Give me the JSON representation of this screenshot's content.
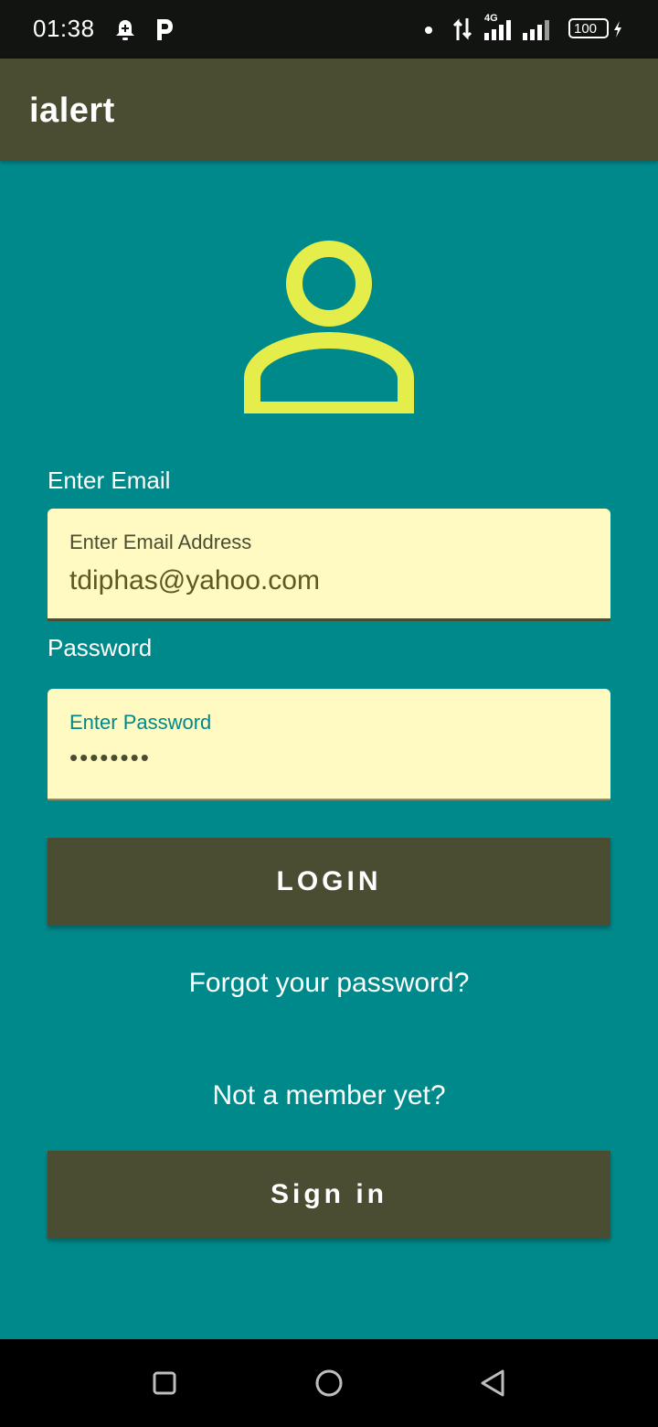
{
  "status_bar": {
    "time": "01:38",
    "icons": [
      "notification-bell-icon",
      "p-app-icon",
      "dot-icon",
      "data-arrows-icon",
      "4g-signal-icon",
      "signal-bars-icon",
      "battery-icon",
      "charging-bolt-icon"
    ],
    "network_label": "4G",
    "battery_level": "100"
  },
  "app_bar": {
    "title": "ialert"
  },
  "login": {
    "avatar_icon": "person-icon",
    "avatar_color": "#e4ed4a",
    "email_heading": "Enter Email",
    "email_label": "Enter Email Address",
    "email_value": "tdiphas@yahoo.com",
    "password_heading": "Password",
    "password_label": "Enter Password",
    "password_value": "••••••••",
    "login_button": "LOGIN",
    "forgot_link": "Forgot your password?",
    "not_member_text": "Not a member yet?",
    "signin_button": "Sign in"
  },
  "colors": {
    "background": "#00898a",
    "app_bar": "#4b4d32",
    "field_background": "#fff9c2",
    "accent": "#e4ed4a"
  },
  "nav_bar": {
    "icons": [
      "recent-apps-icon",
      "home-icon",
      "back-icon"
    ]
  }
}
